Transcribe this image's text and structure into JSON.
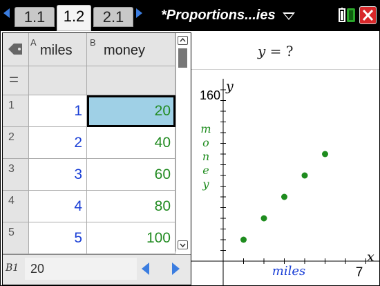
{
  "tabs": [
    {
      "label": "1.1",
      "active": false
    },
    {
      "label": "1.2",
      "active": true
    },
    {
      "label": "2.1",
      "active": false
    }
  ],
  "document_title": "*Proportions...ies",
  "spreadsheet": {
    "columns": [
      {
        "letter": "A",
        "name": "miles"
      },
      {
        "letter": "B",
        "name": "money"
      }
    ],
    "formula_row_symbol": "=",
    "rows": [
      {
        "num": "1",
        "a": "1",
        "b": "20"
      },
      {
        "num": "2",
        "a": "2",
        "b": "40"
      },
      {
        "num": "3",
        "a": "3",
        "b": "60"
      },
      {
        "num": "4",
        "a": "4",
        "b": "80"
      },
      {
        "num": "5",
        "a": "5",
        "b": "100"
      }
    ],
    "selected_cell": "B1",
    "entry_value": "20"
  },
  "graph": {
    "entry_line": {
      "y_label": "y",
      "rest": " = ?"
    },
    "y_axis_label": "y",
    "x_axis_label": "x",
    "y_max_label": "160",
    "x_max_label": "7",
    "y_variable": "money",
    "x_variable": "miles",
    "point_color": "#1e8c1e"
  },
  "chart_data": {
    "type": "scatter",
    "x": [
      1,
      2,
      3,
      4,
      5
    ],
    "y": [
      20,
      40,
      60,
      80,
      100
    ],
    "xlabel": "miles",
    "ylabel": "money",
    "xlim": [
      0,
      7
    ],
    "ylim": [
      0,
      160
    ]
  }
}
